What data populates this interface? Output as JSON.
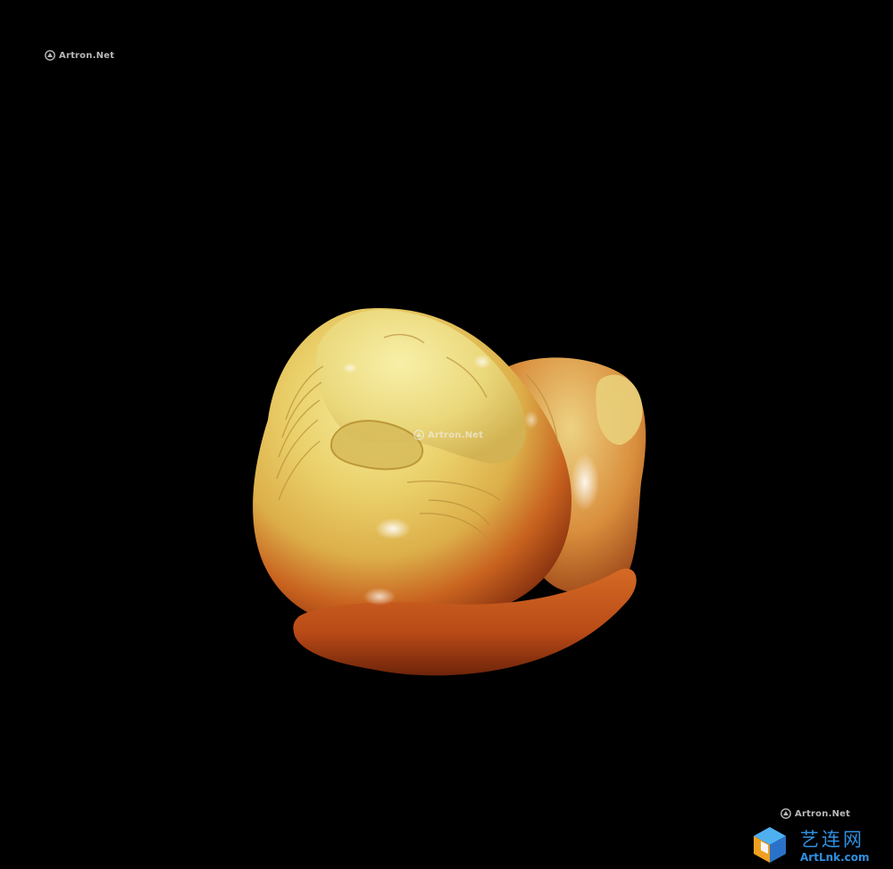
{
  "photo": {
    "background_color": "#000000",
    "subject": "carved yellow-to-russet jade recumbent horse",
    "jade_colors": {
      "highlight": "#f3e58f",
      "body": "#e6c65a",
      "russet": "#c9561c",
      "shadow": "#7a2a0c"
    }
  },
  "watermarks": {
    "top_left": "Artron.Net",
    "center": "Artron.Net",
    "bottom_right": "Artron.Net",
    "logo_icon": "artron-logo-icon"
  },
  "brand": {
    "chinese_name": "艺连网",
    "domain": "ArtLnk.com",
    "logo_icon": "artlnk-cube-logo-icon",
    "color": "#2f8fe0"
  }
}
